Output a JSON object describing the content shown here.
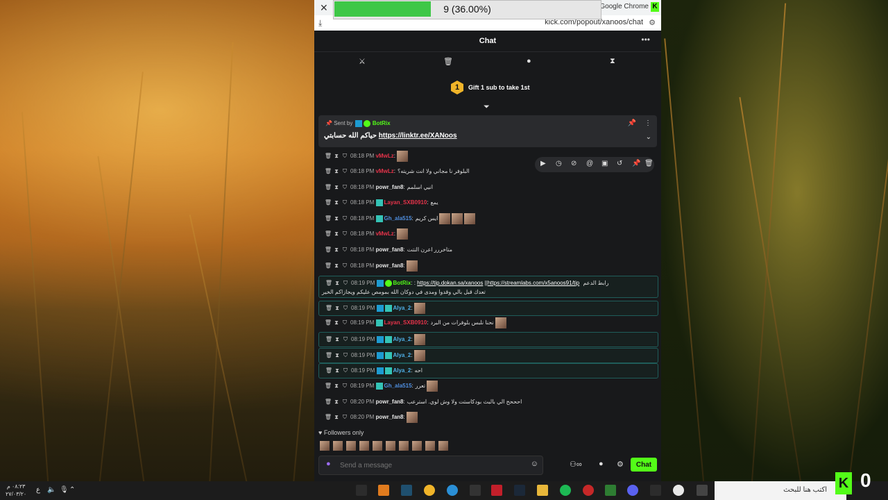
{
  "browser": {
    "window_title": "at - Google Chrome",
    "url": "kick.com/popout/xanoos/chat",
    "progress_text": "9 (36.00%)",
    "progress_fraction": 0.36
  },
  "chat": {
    "title": "Chat",
    "gift_badge": "1",
    "gift_text": "Gift 1 sub to take 1st",
    "pinned": {
      "sent_by": "Sent by",
      "bot_name": "BotRix",
      "message": "حياكم الله حسابتي",
      "link": "https://linktr.ee/XANoos"
    },
    "messages": [
      {
        "time": "08:18 PM",
        "user": "vMwLz",
        "color": "#e6334a",
        "text": "",
        "emotes": 1
      },
      {
        "time": "08:18 PM",
        "user": "vMwLz",
        "color": "#e6334a",
        "text": "البلوفر نا مجاني ولا انت شريته؟",
        "emotes": 0
      },
      {
        "time": "08:18 PM",
        "user": "powr_fan8",
        "color": "#e8e8e8",
        "text": "انيي اسلمم",
        "emotes": 0
      },
      {
        "time": "08:18 PM",
        "user": "Layan_SXB0910",
        "color": "#e6334a",
        "text": "يمع",
        "emotes": 0
      },
      {
        "time": "08:18 PM",
        "user": "Gh_ala515",
        "color": "#4f8fe0",
        "text": "ايس كريم",
        "emotes": 3
      },
      {
        "time": "08:18 PM",
        "user": "vMwLz",
        "color": "#e6334a",
        "text": "",
        "emotes": 1
      },
      {
        "time": "08:18 PM",
        "user": "powr_fan8",
        "color": "#e8e8e8",
        "text": "متاخررر اعرن النتت",
        "emotes": 0
      },
      {
        "time": "08:18 PM",
        "user": "powr_fan8",
        "color": "#e8e8e8",
        "text": "",
        "emotes": 1
      },
      {
        "time": "08:19 PM",
        "user": "BotRix",
        "color": "#53fc18",
        "text": "رابط الدعم",
        "link1": "https://tip.dokan.sa/xanoos",
        "link2": "https://streamlabs.com/x5anoos91/tip",
        "line2": "تعدك قبل بالي وقدوا ومدى في دوكان الله بمومص عليكم ويجازاكم الخير",
        "emotes": 0
      },
      {
        "time": "08:19 PM",
        "user": "Alya_2",
        "color": "#4fb0e8",
        "text": "",
        "emotes": 1
      },
      {
        "time": "08:19 PM",
        "user": "Layan_SXB0910",
        "color": "#e6334a",
        "text": "نحنا نلبس بلوفرات من البرد",
        "emotes": 1
      },
      {
        "time": "08:19 PM",
        "user": "Alya_2",
        "color": "#4fb0e8",
        "text": "",
        "emotes": 1
      },
      {
        "time": "08:19 PM",
        "user": "Alya_2",
        "color": "#4fb0e8",
        "text": "",
        "emotes": 1
      },
      {
        "time": "08:19 PM",
        "user": "Alya_2",
        "color": "#4fb0e8",
        "text": "احه",
        "emotes": 0
      },
      {
        "time": "08:19 PM",
        "user": "Gh_ala515",
        "color": "#4f8fe0",
        "text": "تعرر",
        "emotes": 1
      },
      {
        "time": "08:20 PM",
        "user": "powr_fan8",
        "color": "#e8e8e8",
        "text": "احححح الي بالبث بودكاستت ولا وش لوي. استرعب",
        "emotes": 0
      },
      {
        "time": "08:20 PM",
        "user": "powr_fan8",
        "color": "#e8e8e8",
        "text": "",
        "emotes": 1
      }
    ],
    "followers_only": "Followers only",
    "input_placeholder": "Send a message",
    "send_label": "Chat"
  },
  "taskbar": {
    "time": "٠٨:٢٣ م",
    "date": "٢٧/٠٣/٢٠",
    "lang": "ع",
    "search_placeholder": "اكتب هنا للبحث",
    "kick_logo": "K",
    "kick_count": "0"
  }
}
